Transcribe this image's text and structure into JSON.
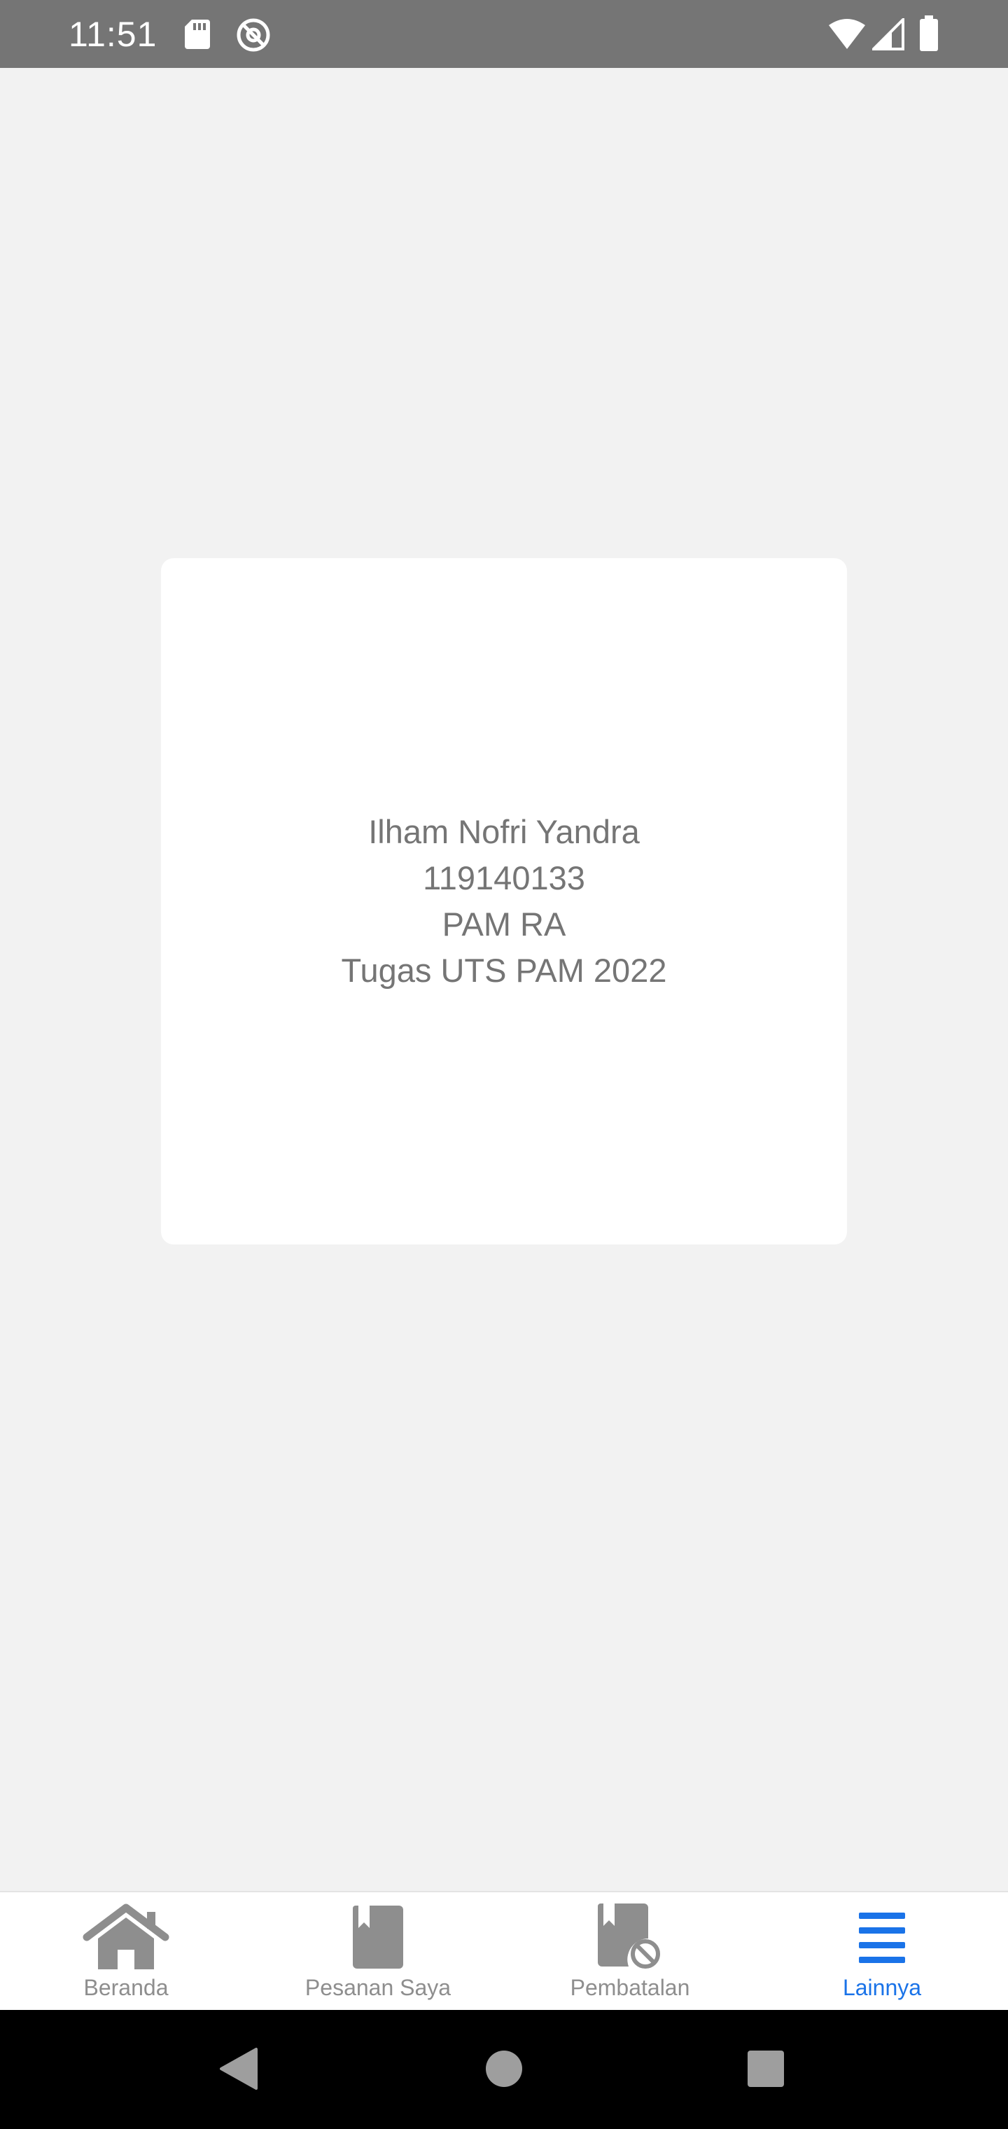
{
  "status_bar": {
    "time": "11:51",
    "icons": [
      "sd-card-icon",
      "no-disturb-icon",
      "wifi-icon",
      "signal-icon",
      "battery-icon"
    ]
  },
  "card": {
    "lines": [
      "Ilham Nofri Yandra",
      "119140133",
      "PAM RA",
      "Tugas UTS PAM 2022"
    ]
  },
  "tab_bar": {
    "active_color": "#1a73e8",
    "inactive_color": "#8e8e8e",
    "tabs": [
      {
        "label": "Beranda",
        "icon": "home-icon",
        "active": false
      },
      {
        "label": "Pesanan Saya",
        "icon": "bookmark-icon",
        "active": false
      },
      {
        "label": "Pembatalan",
        "icon": "bookmark-cancel-icon",
        "active": false
      },
      {
        "label": "Lainnya",
        "icon": "menu-icon",
        "active": true
      }
    ]
  },
  "nav_bar": {
    "buttons": [
      "back-icon",
      "home-circle-icon",
      "recents-icon"
    ]
  }
}
